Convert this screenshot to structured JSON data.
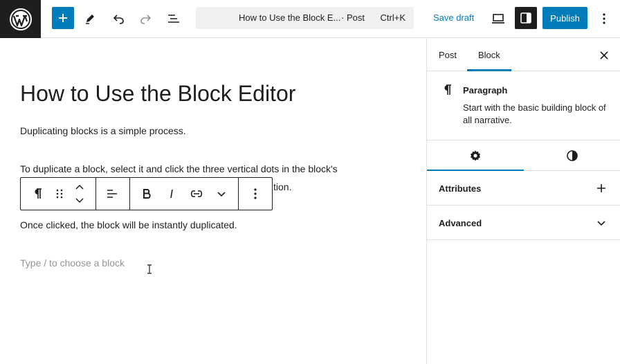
{
  "header": {
    "logo": "wordpress-logo",
    "add_icon": "plus-icon",
    "tools_icon": "pencil-icon",
    "undo_icon": "undo-icon",
    "redo_icon": "redo-icon",
    "outline_icon": "list-view-icon",
    "command_bar": {
      "title": "How to Use the Block E...",
      "post_type": "· Post",
      "shortcut": "Ctrl+K"
    },
    "save_draft": "Save draft",
    "preview_icon": "laptop-icon",
    "settings_icon": "sidebar-toggle-icon",
    "publish": "Publish",
    "more_icon": "vertical-dots-icon",
    "accent": "#007cba"
  },
  "editor": {
    "title": "How to Use the Block Editor",
    "paragraphs": [
      "Duplicating blocks is a simple process.",
      "To duplicate a block, select it and click the three vertical dots in the block's",
      "tion.",
      "Once clicked, the block will be instantly duplicated."
    ],
    "placeholder": "Type / to choose a block"
  },
  "block_toolbar": {
    "items": [
      "paragraph-icon",
      "drag-handle-icon",
      "move-up-down-icon",
      "align-icon",
      "bold-icon",
      "italic-icon",
      "link-icon",
      "chevron-down-icon",
      "options-dots-icon"
    ]
  },
  "sidebar": {
    "tabs": [
      "Post",
      "Block"
    ],
    "active_tab": "Block",
    "block_card": {
      "title": "Paragraph",
      "description": "Start with the basic building block of all narrative."
    },
    "sub_tabs": [
      "settings-gear-icon",
      "styles-contrast-icon"
    ],
    "panels": [
      {
        "title": "Attributes",
        "toggle": "plus-icon"
      },
      {
        "title": "Advanced",
        "toggle": "chevron-down-icon"
      }
    ]
  }
}
